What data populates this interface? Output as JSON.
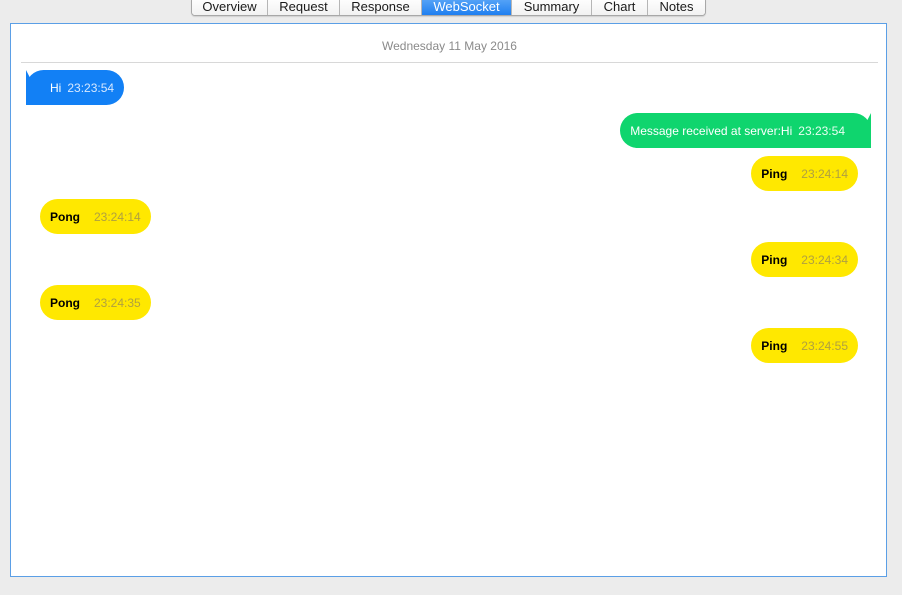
{
  "tabs": [
    {
      "label": "Overview",
      "active": false
    },
    {
      "label": "Request",
      "active": false
    },
    {
      "label": "Response",
      "active": false
    },
    {
      "label": "WebSocket",
      "active": true
    },
    {
      "label": "Summary",
      "active": false
    },
    {
      "label": "Chart",
      "active": false
    },
    {
      "label": "Notes",
      "active": false
    }
  ],
  "conversation": {
    "date": "Wednesday 11 May 2016",
    "messages": [
      {
        "direction": "incoming",
        "kind": "text",
        "text": "Hi",
        "time": "23:23:54"
      },
      {
        "direction": "outgoing",
        "kind": "text",
        "text": "Message received at server:Hi",
        "time": "23:23:54"
      },
      {
        "direction": "outgoing",
        "kind": "ping",
        "text": "Ping",
        "time": "23:24:14"
      },
      {
        "direction": "incoming",
        "kind": "pong",
        "text": "Pong",
        "time": "23:24:14"
      },
      {
        "direction": "outgoing",
        "kind": "ping",
        "text": "Ping",
        "time": "23:24:34"
      },
      {
        "direction": "incoming",
        "kind": "pong",
        "text": "Pong",
        "time": "23:24:35"
      },
      {
        "direction": "outgoing",
        "kind": "ping",
        "text": "Ping",
        "time": "23:24:55"
      }
    ]
  },
  "colors": {
    "incoming_text": "#1280f5",
    "outgoing_text": "#0fd56e",
    "ping_pong": "#ffe800",
    "active_tab": "#1f7ff0",
    "panel_border": "#5b9fe6"
  }
}
